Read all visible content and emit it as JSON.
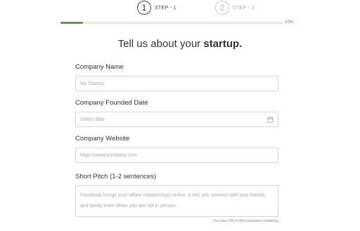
{
  "steps": [
    {
      "number": "1",
      "label": "STEP - 1",
      "active": true
    },
    {
      "number": "2",
      "label": "STEP - 2",
      "active": false
    }
  ],
  "progress": {
    "percent": 10,
    "text": "10%"
  },
  "title": {
    "prefix": "Tell us about your ",
    "emphasis": "startup."
  },
  "form": {
    "company_name": {
      "label": "Company Name",
      "placeholder": "My Startup"
    },
    "founded_date": {
      "label": "Company Founded Date",
      "placeholder": "Select date",
      "icon": "calendar-icon"
    },
    "website": {
      "label": "Company Website",
      "placeholder": "https://www.company.com"
    },
    "pitch": {
      "label": "Short Pitch (1-2 sentences)",
      "placeholder": "Facebook brings your offline relationships online. It lets you connect with your friends and family even when you are not in person.",
      "counter": "You have 200 of 200 characters remaining"
    }
  },
  "colors": {
    "accent": "#6e8f55",
    "track": "#e6e6e0"
  }
}
